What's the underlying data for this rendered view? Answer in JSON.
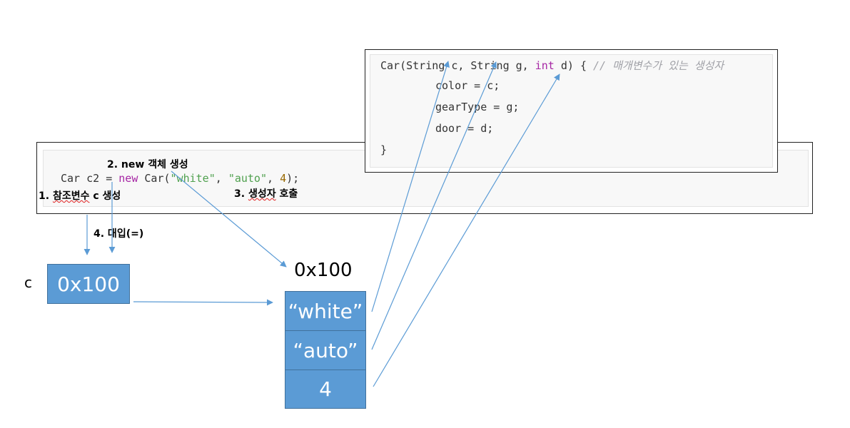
{
  "call_code": {
    "type": "Car",
    "var": "c2",
    "eq": "=",
    "new_kw": "new",
    "ctor": "Car(",
    "arg1": "\"white\"",
    "comma1": ", ",
    "arg2": "\"auto\"",
    "comma2": ", ",
    "arg3": "4",
    "end": ");"
  },
  "constructor_code": {
    "l1_a": "Car(String c, String g, ",
    "l1_kw": "int",
    "l1_b": " d) { ",
    "l1_comment": "// 매개변수가 있는 생성자",
    "l2": "color = c;",
    "l3": "gearType = g;",
    "l4": "door = d;",
    "l5": "}"
  },
  "steps": {
    "s1_prefix": "1. ",
    "s1_under": "참조변수",
    "s1_rest": " c 생성",
    "s2": "2. new 객체 생성",
    "s3_prefix": "3. ",
    "s3_under": "생성자",
    "s3_rest": " 호출",
    "s4": "4. 대입(=)"
  },
  "memory": {
    "ref_label": "c",
    "ref_value": "0x100",
    "obj_address": "0x100",
    "fields": [
      "“white”",
      "“auto”",
      "4"
    ]
  },
  "colors": {
    "box_fill": "#5b9bd5",
    "arrow": "#5b9bd5"
  }
}
